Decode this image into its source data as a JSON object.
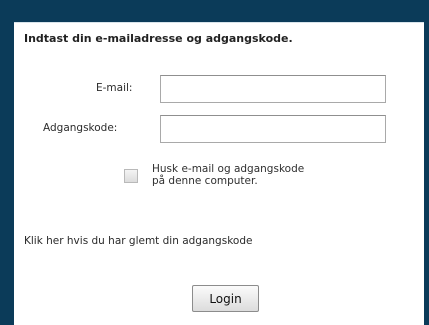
{
  "login_form": {
    "heading": "Indtast din e-mailadresse og adgangskode.",
    "email_label": "E-mail:",
    "email_value": "",
    "password_label": "Adgangskode:",
    "password_value": "",
    "remember": {
      "line_1": "Husk e-mail og adgangskode",
      "line_2": "på denne computer.",
      "checked": false
    },
    "forgot_link": "Klik her hvis du har glemt din adgangskode",
    "login_button": "Login"
  },
  "theme": {
    "frame_color": "#0b3b59",
    "panel_color": "#ffffff"
  }
}
